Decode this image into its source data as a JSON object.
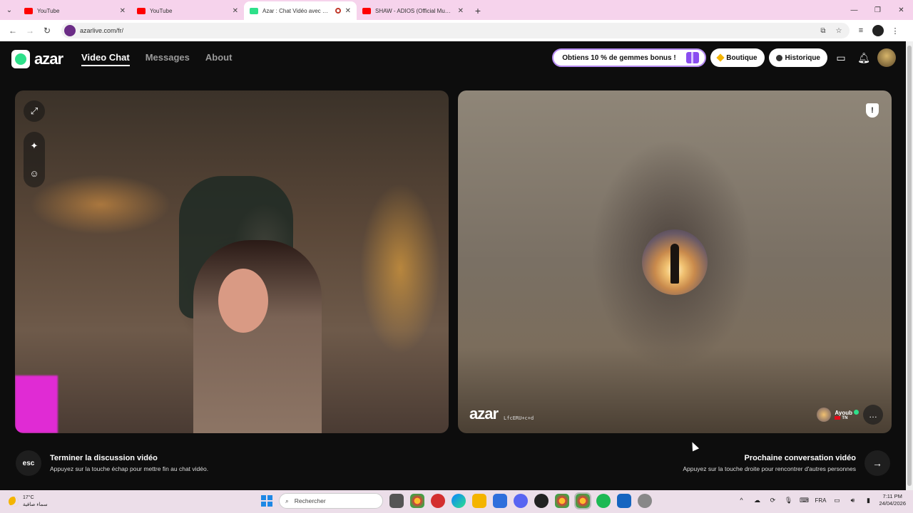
{
  "browser": {
    "tabs": [
      {
        "title": "YouTube",
        "color": "#ff0000",
        "active": false
      },
      {
        "title": "YouTube",
        "color": "#ff0000",
        "active": false
      },
      {
        "title": "Azar : Chat Vidéo avec de n",
        "color": "#2ee08a",
        "active": true
      },
      {
        "title": "SHAW - ADIOS (Official Music V",
        "color": "#ff0000",
        "active": false
      }
    ],
    "url": "azarlive.com/fr/"
  },
  "app": {
    "brand": "azar",
    "nav": [
      {
        "label": "Video Chat",
        "active": true
      },
      {
        "label": "Messages",
        "active": false
      },
      {
        "label": "About",
        "active": false
      }
    ],
    "promo": "Obtiens 10 % de gemmes bonus !",
    "shop": "Boutique",
    "history": "Historique",
    "accent": "#2ee08a"
  },
  "partner": {
    "name": "Ayoub",
    "country": "TN",
    "session_id": "LfcERU+c+d",
    "watermark": "azar"
  },
  "hints": {
    "end_key": "esc",
    "end_title": "Terminer la discussion vidéo",
    "end_sub": "Appuyez sur la touche échap pour mettre fin au chat vidéo.",
    "next_title": "Prochaine conversation vidéo",
    "next_sub": "Appuyez sur la touche droite pour rencontrer d'autres personnes"
  },
  "taskbar": {
    "temp": "17°C",
    "weather": "سماء صافية",
    "search_placeholder": "Rechercher",
    "lang": "FRA",
    "time": "7:11 PM",
    "date": "24/04/2026"
  }
}
